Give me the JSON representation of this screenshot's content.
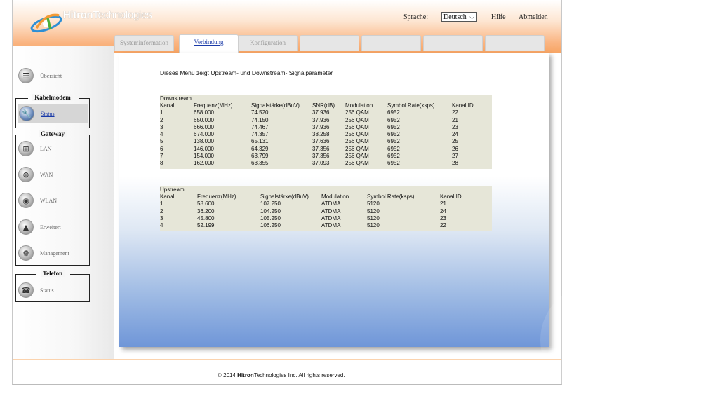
{
  "brand": {
    "name_bold": "Hitron",
    "name_thin": "Technologies"
  },
  "header": {
    "language_label": "Sprache:",
    "language_value": "Deutsch",
    "help": "Hilfe",
    "logout": "Abmelden"
  },
  "tabs": [
    {
      "label": "Systeminformation",
      "active": false
    },
    {
      "label": "Verbindung",
      "active": true
    },
    {
      "label": "Konfiguration",
      "active": false
    },
    {
      "label": "",
      "active": false
    },
    {
      "label": "",
      "active": false
    },
    {
      "label": "",
      "active": false
    },
    {
      "label": "",
      "active": false
    }
  ],
  "sidebar": {
    "overview": "Übersicht",
    "cable_modem": {
      "title": "Kabelmodem",
      "items": [
        "Status"
      ]
    },
    "gateway": {
      "title": "Gateway",
      "items": [
        "LAN",
        "WAN",
        "WLAN",
        "Erweitert",
        "Management"
      ]
    },
    "telephone": {
      "title": "Telefon",
      "items": [
        "Status"
      ]
    }
  },
  "main": {
    "intro": "Dieses Menü zeigt Upstream- und Downstream- Signalparameter",
    "downstream": {
      "title": "Downstream",
      "headers": [
        "Kanal",
        "Frequenz(MHz)",
        "Signalstärke(dBuV)",
        "SNR(dB)",
        "Modulation",
        "Symbol Rate(ksps)",
        "Kanal ID"
      ],
      "rows": [
        [
          "1",
          "658.000",
          "74.520",
          "37.936",
          "256 QAM",
          "6952",
          "22"
        ],
        [
          "2",
          "650.000",
          "74.150",
          "37.936",
          "256 QAM",
          "6952",
          "21"
        ],
        [
          "3",
          "666.000",
          "74.467",
          "37.936",
          "256 QAM",
          "6952",
          "23"
        ],
        [
          "4",
          "674.000",
          "74.357",
          "38.258",
          "256 QAM",
          "6952",
          "24"
        ],
        [
          "5",
          "138.000",
          "65.131",
          "37.636",
          "256 QAM",
          "6952",
          "25"
        ],
        [
          "6",
          "146.000",
          "64.329",
          "37.356",
          "256 QAM",
          "6952",
          "26"
        ],
        [
          "7",
          "154.000",
          "63.799",
          "37.356",
          "256 QAM",
          "6952",
          "27"
        ],
        [
          "8",
          "162.000",
          "63.355",
          "37.093",
          "256 QAM",
          "6952",
          "28"
        ]
      ]
    },
    "upstream": {
      "title": "Upstream",
      "headers": [
        "Kanal",
        "Frequenz(MHz)",
        "Signalstärke(dBuV)",
        "Modulation",
        "Symbol Rate(ksps)",
        "Kanal ID"
      ],
      "rows": [
        [
          "1",
          "58.600",
          "107.250",
          "ATDMA",
          "5120",
          "21"
        ],
        [
          "2",
          "36.200",
          "104.250",
          "ATDMA",
          "5120",
          "24"
        ],
        [
          "3",
          "45.800",
          "105.250",
          "ATDMA",
          "5120",
          "23"
        ],
        [
          "4",
          "52.199",
          "106.250",
          "ATDMA",
          "5120",
          "22"
        ]
      ]
    }
  },
  "footer": {
    "prefix": "© 2014",
    "brand_bold": "Hitron",
    "brand_thin": "Technologies",
    "suffix": "Inc.  All rights reserved."
  },
  "colors": {
    "header_orange": "#f7a565",
    "link_blue": "#1a3aa8",
    "content_blue": "#6f96d8",
    "table_bg": "#e6e6d8"
  }
}
